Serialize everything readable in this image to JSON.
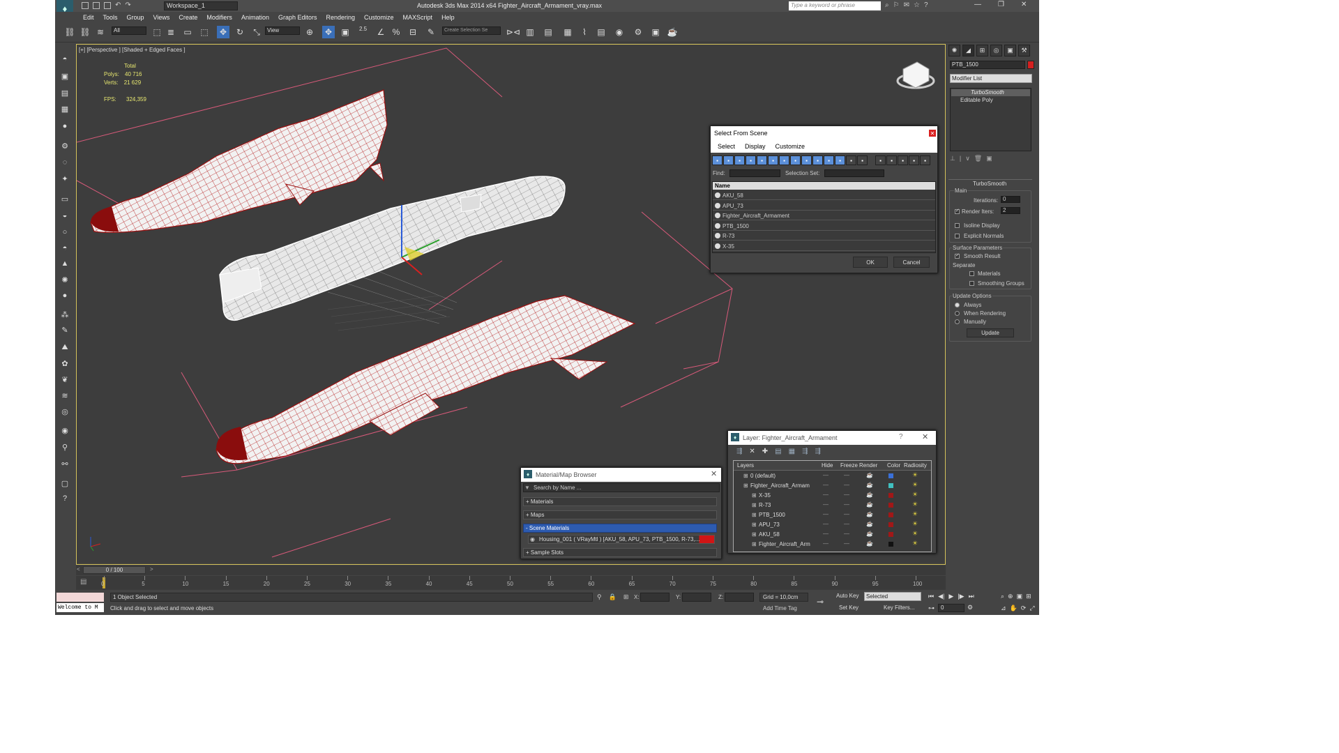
{
  "title_bar": {
    "workspace": "Workspace_1",
    "title": "Autodesk 3ds Max  2014 x64     Fighter_Aircraft_Armament_vray.max",
    "search_placeholder": "Type a keyword or phrase"
  },
  "menu": [
    "Edit",
    "Tools",
    "Group",
    "Views",
    "Create",
    "Modifiers",
    "Animation",
    "Graph Editors",
    "Rendering",
    "Customize",
    "MAXScript",
    "Help"
  ],
  "toolbar": {
    "filter": "All",
    "coord_system": "View",
    "spinner_snap": "2.5",
    "selection_set": "Create Selection Se"
  },
  "viewport": {
    "label": "[+] [Perspective ] [Shaded + Edged Faces ]",
    "stats": {
      "total": "Total",
      "polys_label": "Polys:",
      "polys": "40 716",
      "verts_label": "Verts:",
      "verts": "21 629",
      "fps_label": "FPS:",
      "fps": "324,359"
    }
  },
  "select_dialog": {
    "title": "Select From Scene",
    "menu": [
      "Select",
      "Display",
      "Customize"
    ],
    "find_label": "Find:",
    "selset_label": "Selection Set:",
    "col_name": "Name",
    "items": [
      "AKU_58",
      "APU_73",
      "Fighter_Aircraft_Armament",
      "PTB_1500",
      "R-73",
      "X-35"
    ],
    "ok": "OK",
    "cancel": "Cancel"
  },
  "command_panel": {
    "object_name": "PTB_1500",
    "object_color": "#d42020",
    "modifier_list": "Modifier List",
    "stack": [
      "TurboSmooth",
      "Editable Poly"
    ],
    "turbosmooth": {
      "title": "TurboSmooth",
      "main": "Main",
      "iterations_label": "Iterations:",
      "iterations": "0",
      "render_iters_label": "Render Iters:",
      "render_iters": "2",
      "isoline": "Isoline Display",
      "explicit": "Explicit Normals",
      "surface": "Surface Parameters",
      "smooth_result": "Smooth Result",
      "separate": "Separate",
      "materials": "Materials",
      "smoothing": "Smoothing Groups",
      "update_options": "Update Options",
      "always": "Always",
      "when_rendering": "When Rendering",
      "manually": "Manually",
      "update_btn": "Update"
    }
  },
  "layer_dialog": {
    "title": "Layer: Fighter_Aircraft_Armament",
    "cols": [
      "Layers",
      "Hide",
      "Freeze",
      "Render",
      "Color",
      "Radiosity"
    ],
    "rows": [
      {
        "name": "0 (default)",
        "indent": 0,
        "color": "#3a70d8"
      },
      {
        "name": "Fighter_Aircraft_Armam",
        "indent": 1,
        "color": "#40c0c0"
      },
      {
        "name": "X-35",
        "indent": 2,
        "color": "#a01818"
      },
      {
        "name": "R-73",
        "indent": 2,
        "color": "#a01818"
      },
      {
        "name": "PTB_1500",
        "indent": 2,
        "color": "#a01818"
      },
      {
        "name": "APU_73",
        "indent": 2,
        "color": "#a01818"
      },
      {
        "name": "AKU_58",
        "indent": 2,
        "color": "#a01818"
      },
      {
        "name": "Fighter_Aircraft_Arm",
        "indent": 2,
        "color": "#111111"
      }
    ]
  },
  "mat_browser": {
    "title": "Material/Map Browser",
    "search": "Search by Name ...",
    "materials": "+ Materials",
    "maps": "+ Maps",
    "scene": "- Scene Materials",
    "housing": "Housing_001  ( VRayMtl )  [AKU_58, APU_73, PTB_1500, R-73,...",
    "samples": "+ Sample Slots"
  },
  "timeline": {
    "frame": "0 / 100",
    "ticks": [
      "0",
      "5",
      "10",
      "15",
      "20",
      "25",
      "30",
      "35",
      "40",
      "45",
      "50",
      "55",
      "60",
      "65",
      "70",
      "75",
      "80",
      "85",
      "90",
      "95",
      "100"
    ]
  },
  "status": {
    "welcome": "Welcome to M",
    "selected": "1 Object Selected",
    "prompt": "Click and drag to select and move objects",
    "x": "X:",
    "y": "Y:",
    "z": "Z:",
    "grid": "Grid = 10,0cm",
    "add_tag": "Add Time Tag",
    "auto_key": "Auto Key",
    "set_key": "Set Key",
    "key_sel": "Selected",
    "key_filters": "Key Filters...",
    "frame_box": "0"
  }
}
